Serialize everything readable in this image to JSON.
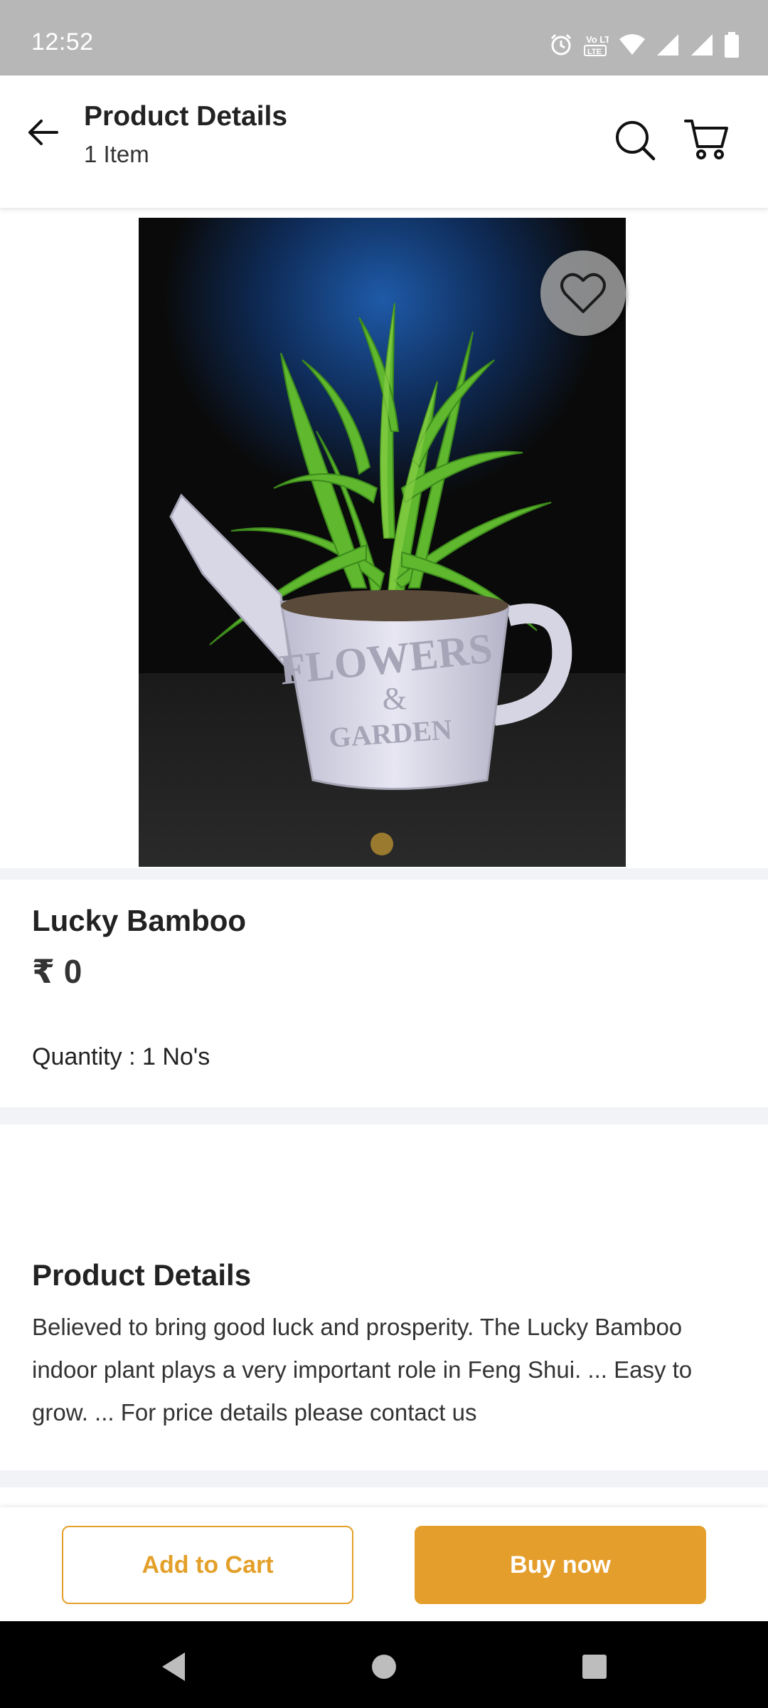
{
  "status_bar": {
    "time": "12:52",
    "volte_label": "Vo LTE",
    "icons": [
      "alarm-icon",
      "volte-icon",
      "wifi-icon",
      "signal-icon",
      "signal-icon",
      "battery-icon"
    ]
  },
  "header": {
    "title": "Product Details",
    "subtitle": "1 Item",
    "icons": [
      "back-arrow-icon",
      "search-icon",
      "cart-icon"
    ]
  },
  "product": {
    "image_alt": "Lucky Bamboo plant in a white watering-can pot",
    "pot_text_line1": "FLOWERS",
    "pot_text_line2": "&",
    "pot_text_line3": "GARDEN",
    "name": "Lucky Bamboo",
    "price": "₹ 0",
    "quantity": "Quantity : 1 No's",
    "favorite_icon": "heart-outline-icon",
    "carousel_active_index": 0,
    "carousel_count": 1
  },
  "details": {
    "heading": "Product Details",
    "description": "Believed to bring good luck and prosperity. The Lucky Bamboo indoor plant plays a very important role in Feng Shui. ... Easy to grow. ... For price details please contact us"
  },
  "actions": {
    "add_to_cart": "Add to Cart",
    "buy_now": "Buy now"
  },
  "colors": {
    "accent": "#e49e2b",
    "status_bar": "#b7b7b7",
    "divider": "#f2f3f7"
  },
  "nav_bar": {
    "icons": [
      "nav-back-icon",
      "nav-home-icon",
      "nav-recents-icon"
    ]
  }
}
